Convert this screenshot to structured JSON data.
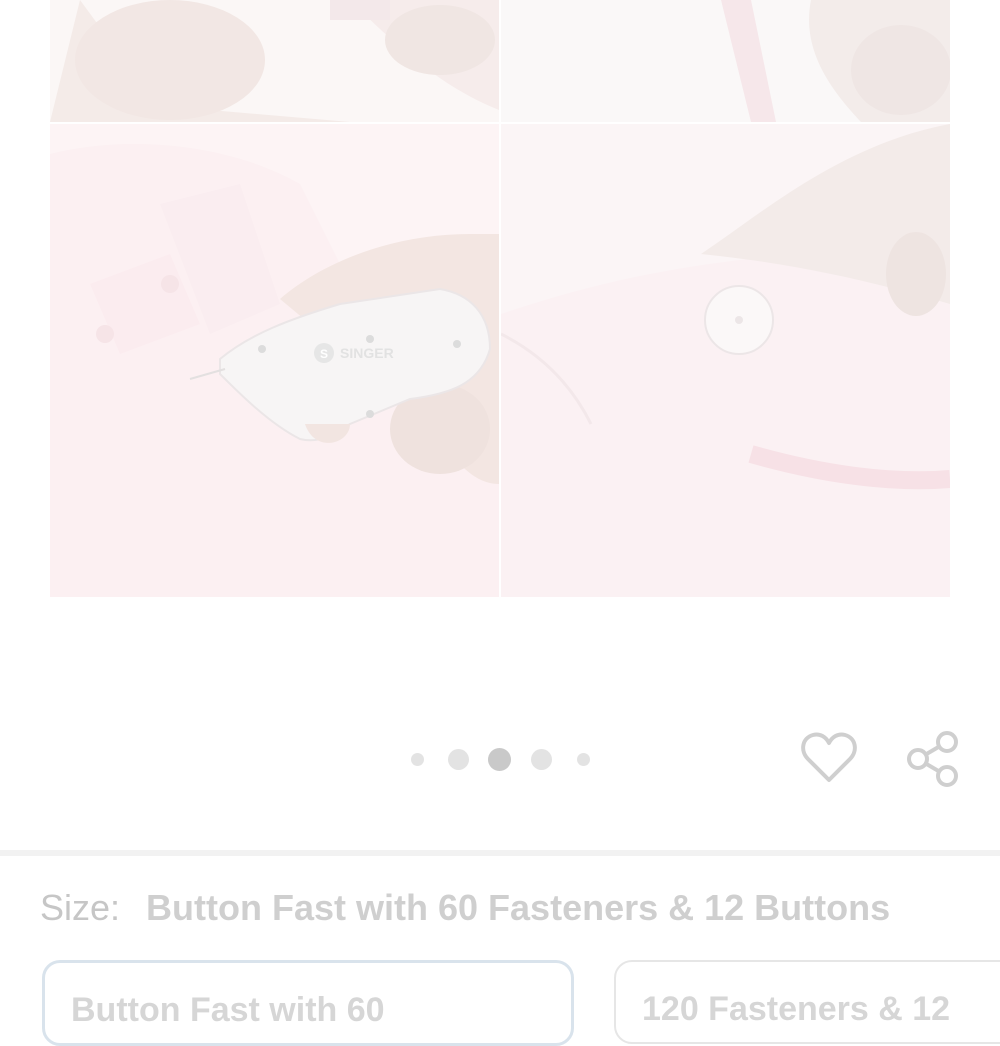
{
  "gallery": {
    "images": [
      {
        "name": "product-photo-1"
      },
      {
        "name": "product-photo-2"
      },
      {
        "name": "product-photo-3",
        "brand_text": "SINGER"
      },
      {
        "name": "product-photo-4"
      }
    ],
    "pager": {
      "count": 5,
      "active_index": 2
    }
  },
  "actions": {
    "favorite_icon": "heart-icon",
    "share_icon": "share-icon"
  },
  "size": {
    "label": "Size:",
    "selected_value": "Button Fast with 60 Fasteners & 12 Buttons",
    "options": [
      {
        "label": "Button Fast with 60",
        "selected": true
      },
      {
        "label": "120 Fasteners & 12",
        "selected": false
      }
    ]
  },
  "colors": {
    "selected_border": "#d9e3ec"
  }
}
